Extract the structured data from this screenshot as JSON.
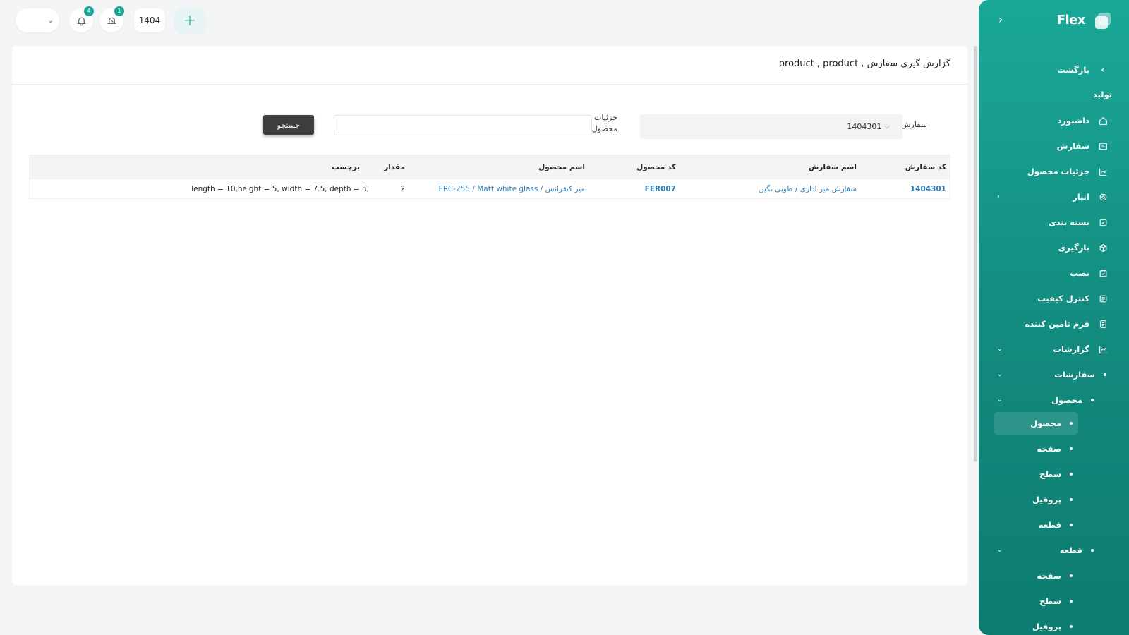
{
  "topbar": {
    "year": "1404",
    "notif_count": "4",
    "msg_count": "1",
    "add_symbol": "+",
    "icons": [
      "chevron-down-icon",
      "bell-icon",
      "notification-icon",
      "plus-icon"
    ]
  },
  "page": {
    "title": "گزارش گیری سفارش , product , product"
  },
  "filters": {
    "order_label": "سفارش:",
    "order_value": "1404301",
    "detail_label": "جزئیات محصول:",
    "detail_value": "",
    "search_label": "جستجو"
  },
  "table": {
    "headers": {
      "order_code": "کد سفارش",
      "order_name": "اسم سفارش",
      "product_code": "کد محصول",
      "product_name": "اسم محصول",
      "quantity": "مقدار",
      "tag": "برچسب"
    },
    "rows": [
      {
        "order_code": "1404301",
        "order_name": "سفارش میز اداری / طوبی نگین",
        "product_code": "FER007",
        "product_name": "میز کنفرانس / ERC-255 / Matt white glass",
        "quantity": "2",
        "tag": "length = 10,height = 5, width = 7.5, depth = 5,"
      }
    ]
  },
  "sidebar": {
    "brand": "Flex",
    "back": "بازگشت",
    "section": "تولید",
    "items": [
      {
        "label": "داشبورد",
        "icon": "home-icon"
      },
      {
        "label": "سفارش",
        "icon": "order-icon"
      },
      {
        "label": "جزئیات محصول",
        "icon": "chart-icon"
      },
      {
        "label": "انبار",
        "icon": "warehouse-icon"
      },
      {
        "label": "بسته بندی",
        "icon": "package-icon"
      },
      {
        "label": "بارگیری",
        "icon": "cube-icon"
      },
      {
        "label": "نصب",
        "icon": "install-icon"
      },
      {
        "label": "کنترل کیفیت",
        "icon": "quality-icon"
      },
      {
        "label": "فرم تامین کننده",
        "icon": "form-icon"
      },
      {
        "label": "گزارشات",
        "icon": "report-icon"
      }
    ],
    "reports": {
      "orders": "سفارشات",
      "product": "محصول",
      "product_sub": [
        "محصول",
        "صفحه",
        "سطح",
        "پروفیل",
        "قطعه"
      ],
      "part": "قطعه",
      "part_sub": [
        "صفحه",
        "سطح",
        "پروفیل"
      ]
    }
  },
  "colors": {
    "accent": "#17a596",
    "sidebar_top": "#1aa898",
    "sidebar_bottom": "#0e7c70",
    "link": "#2f7fb8"
  }
}
